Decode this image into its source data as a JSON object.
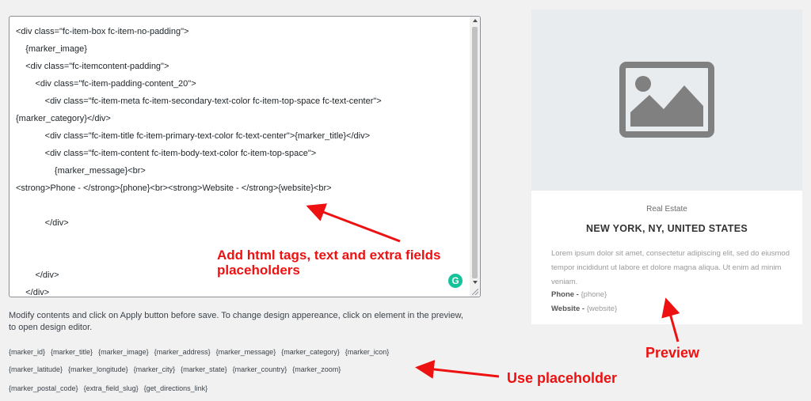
{
  "editor": {
    "code_lines": [
      "<div class=\"fc-item-box fc-item-no-padding\">",
      "    {marker_image}",
      "    <div class=\"fc-itemcontent-padding\">",
      "        <div class=\"fc-item-padding-content_20\">",
      "            <div class=\"fc-item-meta fc-item-secondary-text-color fc-item-top-space fc-text-center\">",
      "{marker_category}</div>",
      "            <div class=\"fc-item-title fc-item-primary-text-color fc-text-center\">{marker_title}</div>",
      "            <div class=\"fc-item-content fc-item-body-text-color fc-item-top-space\">",
      "                {marker_message}<br>",
      "<strong>Phone - </strong>{phone}<br><strong>Website - </strong>{website}<br>",
      "",
      "            </div>",
      "",
      "",
      "        </div>",
      "    </div>",
      "</div>"
    ]
  },
  "help_text": "Modify contents and click on Apply button before save. To change design appereance, click on element in the preview, to open design editor.",
  "placeholders": {
    "row1": [
      "{marker_id}",
      "{marker_title}",
      "{marker_image}",
      "{marker_address}",
      "{marker_message}",
      "{marker_category}",
      "{marker_icon}"
    ],
    "row2": [
      "{marker_latitude}",
      "{marker_longitude}",
      "{marker_city}",
      "{marker_state}",
      "{marker_country}",
      "{marker_zoom}"
    ],
    "row3": [
      "{marker_postal_code}",
      "{extra_field_slug}",
      "{get_directions_link}"
    ]
  },
  "annotations": {
    "add_html": "Add html tags, text and extra fields placeholders",
    "preview": "Preview",
    "use_placeholder": "Use placeholder",
    "color": "#ee1111"
  },
  "preview": {
    "category": "Real Estate",
    "title": "NEW YORK, NY, UNITED STATES",
    "message": "Lorem ipsum dolor sit amet, consectetur adipiscing elit, sed do eiusmod tempor incididunt ut labore et dolore magna aliqua. Ut enim ad minim veniam.",
    "phone_label": "Phone -",
    "phone_value": "{phone}",
    "website_label": "Website -",
    "website_value": "{website}",
    "image_icon": "image-placeholder-icon"
  },
  "grammarly_icon": "G"
}
